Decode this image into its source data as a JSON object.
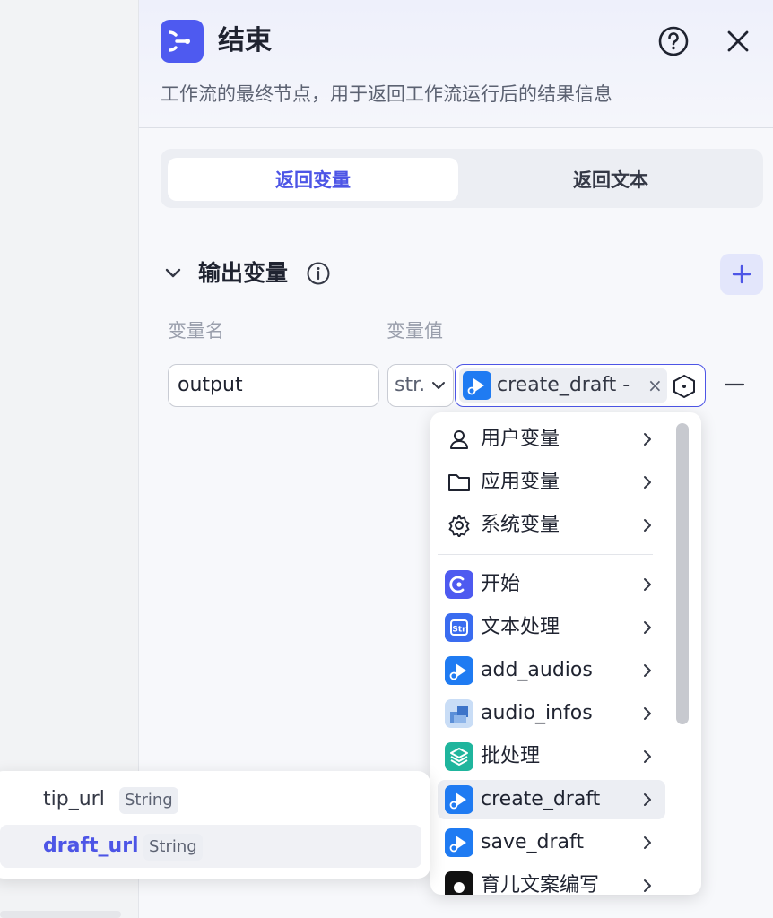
{
  "panel": {
    "title": "结束",
    "description": "工作流的最终节点，用于返回工作流运行后的结果信息",
    "accent_color": "#4e5af0"
  },
  "tabs": [
    {
      "label": "返回变量",
      "active": true
    },
    {
      "label": "返回文本",
      "active": false
    }
  ],
  "section": {
    "title": "输出变量",
    "columns": {
      "name": "变量名",
      "value": "变量值"
    }
  },
  "row": {
    "name": "output",
    "type": "str.",
    "reference": "create_draft -",
    "clear": "×"
  },
  "dropdown": {
    "items": [
      {
        "label": "用户变量",
        "icon": "user-icon"
      },
      {
        "label": "应用变量",
        "icon": "folder-icon"
      },
      {
        "label": "系统变量",
        "icon": "gear-icon"
      },
      {
        "label": "开始",
        "icon": "start-node-icon"
      },
      {
        "label": "文本处理",
        "icon": "text-process-icon"
      },
      {
        "label": "add_audios",
        "icon": "plugin-play-icon"
      },
      {
        "label": "audio_infos",
        "icon": "plugin-image-icon"
      },
      {
        "label": "批处理",
        "icon": "batch-icon"
      },
      {
        "label": "create_draft",
        "icon": "plugin-play-icon"
      },
      {
        "label": "save_draft",
        "icon": "plugin-play-icon"
      },
      {
        "label": "育儿文案编写",
        "icon": "llm-icon"
      }
    ]
  },
  "submenu": {
    "items": [
      {
        "name": "tip_url",
        "type": "String",
        "selected": false
      },
      {
        "name": "draft_url",
        "type": "String",
        "selected": true
      }
    ]
  }
}
